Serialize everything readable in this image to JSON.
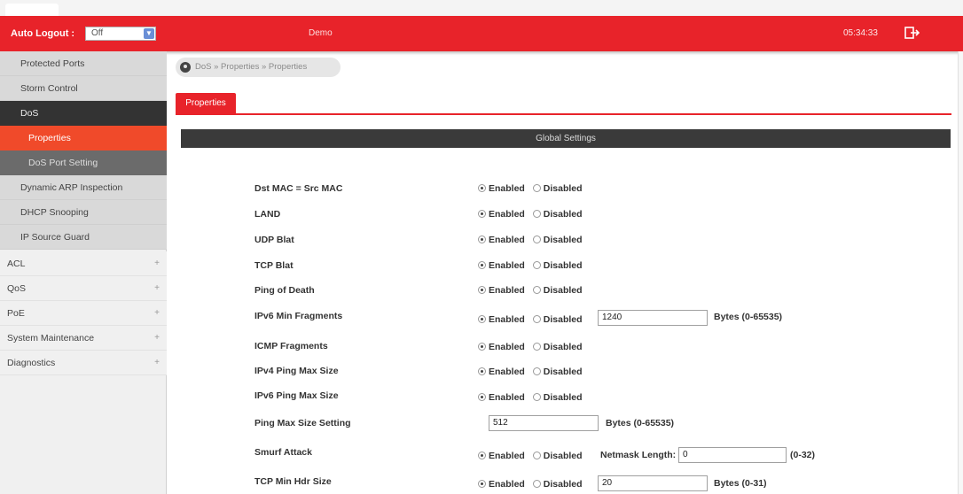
{
  "header": {
    "auto_logout_label": "Auto Logout :",
    "auto_logout_value": "Off",
    "device_name": "Demo",
    "clock": "05:34:33"
  },
  "sidebar": {
    "items": [
      {
        "label": "Protected Ports"
      },
      {
        "label": "Storm Control"
      },
      {
        "label": "DoS"
      },
      {
        "label": "Properties"
      },
      {
        "label": "DoS Port Setting"
      },
      {
        "label": "Dynamic ARP Inspection"
      },
      {
        "label": "DHCP Snooping"
      },
      {
        "label": "IP Source Guard"
      },
      {
        "label": "ACL"
      },
      {
        "label": "QoS"
      },
      {
        "label": "PoE"
      },
      {
        "label": "System Maintenance"
      },
      {
        "label": "Diagnostics"
      }
    ],
    "expand_symbol": "+"
  },
  "breadcrumb": {
    "text": "DoS  » Properties  » Properties"
  },
  "tab": {
    "label": "Properties"
  },
  "section": {
    "title": "Global Settings"
  },
  "options": {
    "enabled": "Enabled",
    "disabled": "Disabled"
  },
  "rows": [
    {
      "label": "Dst MAC = Src MAC"
    },
    {
      "label": "LAND"
    },
    {
      "label": "UDP Blat"
    },
    {
      "label": "TCP Blat"
    },
    {
      "label": "Ping of Death"
    },
    {
      "label": "IPv6 Min Fragments",
      "value": "1240",
      "hint": "Bytes (0-65535)"
    },
    {
      "label": "ICMP Fragments"
    },
    {
      "label": "IPv4 Ping Max Size"
    },
    {
      "label": "IPv6 Ping Max Size"
    },
    {
      "label": "Ping Max Size Setting",
      "value": "512",
      "hint": "Bytes (0-65535)"
    },
    {
      "label": "Smurf Attack",
      "netmask_label": "Netmask Length:",
      "value": "0",
      "hint": "(0-32)"
    },
    {
      "label": "TCP Min Hdr Size",
      "value": "20",
      "hint": "Bytes (0-31)"
    }
  ]
}
